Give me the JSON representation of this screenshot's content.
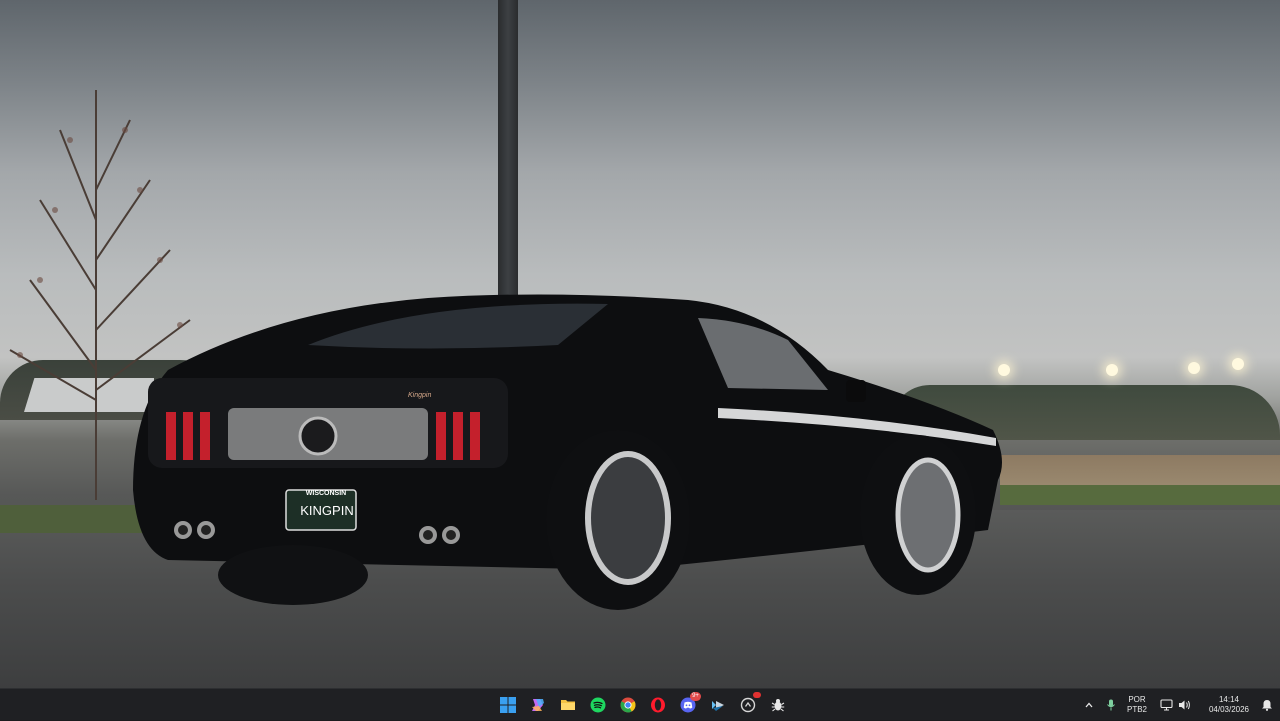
{
  "wallpaper": {
    "car_plate_state": "WISCONSIN",
    "car_plate_text": "KINGPIN",
    "car_badge": "Kingpin"
  },
  "taskbar": {
    "pinned": [
      {
        "name": "start-button",
        "icon": "windows-logo-icon"
      },
      {
        "name": "copilot-button",
        "icon": "copilot-icon"
      },
      {
        "name": "file-explorer-button",
        "icon": "folder-icon"
      },
      {
        "name": "spotify-button",
        "icon": "spotify-icon"
      },
      {
        "name": "chrome-button",
        "icon": "chrome-icon"
      },
      {
        "name": "opera-button",
        "icon": "opera-icon"
      },
      {
        "name": "discord-button",
        "icon": "discord-icon",
        "badge": "9+"
      },
      {
        "name": "steam-button",
        "icon": "steam-icon"
      },
      {
        "name": "app-notification-button",
        "icon": "app-icon"
      },
      {
        "name": "bug-app-button",
        "icon": "bug-icon"
      }
    ],
    "discord_badge": "9+",
    "tray": {
      "language_line1": "POR",
      "language_line2": "PTB2",
      "time": "14:14",
      "date": "04/03/2026"
    },
    "colors": {
      "background": "#1f2023",
      "windows_blue": "#3aa0f0",
      "spotify_green": "#1ed760",
      "opera_red": "#ff1b2d",
      "discord_blurple": "#5865f2"
    }
  }
}
